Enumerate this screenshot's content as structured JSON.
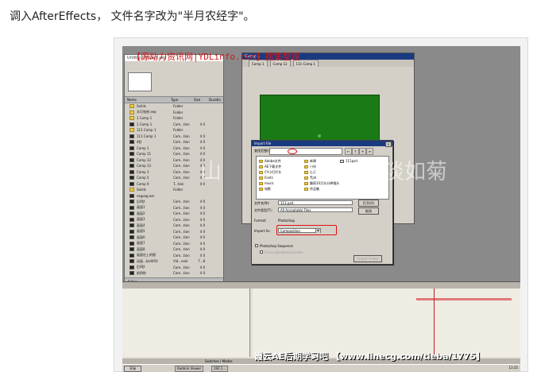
{
  "caption": "调入AfterEffects， 文件名字改为\"半月农经字\"。",
  "watermarks": {
    "top": "【源动力资讯网|YDLinfo.com】搜集整理",
    "calligraphy_left": "山",
    "calligraphy_mid": "素",
    "calligraphy_right": "淡如菊",
    "bottom": "霞云AE后期学习吧 【www.linecg.com/tieba/1775】"
  },
  "project": {
    "title": "Untitled Project.aep",
    "columns": [
      "Name",
      "Type",
      "Size",
      "Duratio"
    ],
    "items": [
      {
        "name": "Solids",
        "type": "Folder",
        "size": ""
      },
      {
        "name": "半月农经.aep",
        "type": "Folder",
        "size": ""
      },
      {
        "name": "1 Comp 1",
        "type": "Folder",
        "size": ""
      },
      {
        "name": "1 Comp 1",
        "type": "Com...tion",
        "size": "4 0"
      },
      {
        "name": "111 Comp 1",
        "type": "Folder",
        "size": ""
      },
      {
        "name": "111 Comp 1",
        "type": "Com...tion",
        "size": "4 0"
      },
      {
        "name": "4秒",
        "type": "Com...tion",
        "size": "4 0"
      },
      {
        "name": "Comp 1",
        "type": "Com...tion",
        "size": "4 0"
      },
      {
        "name": "Comp 11",
        "type": "Com...tion",
        "size": "4 0"
      },
      {
        "name": "Comp 12",
        "type": "Com...tion",
        "size": "4 0"
      },
      {
        "name": "Comp 13",
        "type": "Com...tion",
        "size": "4 0"
      },
      {
        "name": "Comp 3",
        "type": "Com...tion",
        "size": "4 0"
      },
      {
        "name": "Comp 5",
        "type": "Com...tion",
        "size": "4 0"
      },
      {
        "name": "Comp 9",
        "type": "T...tion",
        "size": "4 0"
      },
      {
        "name": "Solids",
        "type": "Folder",
        "size": ""
      },
      {
        "name": "vsguag.aar",
        "type": "",
        "size": ""
      },
      {
        "name": "后4秒",
        "type": "Com...tion",
        "size": "4 0"
      },
      {
        "name": "画面1",
        "type": "Com...tion",
        "size": "4 0"
      },
      {
        "name": "画面2",
        "type": "Com...tion",
        "size": "4 0"
      },
      {
        "name": "画面3",
        "type": "Com...tion",
        "size": "4 0"
      },
      {
        "name": "画面4",
        "type": "Com...tion",
        "size": "4 0"
      },
      {
        "name": "画面5",
        "type": "Com...tion",
        "size": "4 0"
      },
      {
        "name": "画面6",
        "type": "Com...tion",
        "size": "4 0"
      },
      {
        "name": "画面7",
        "type": "Com...tion",
        "size": "4 0"
      },
      {
        "name": "画面8",
        "type": "Com...tion",
        "size": "4 0"
      },
      {
        "name": "画面在上的图",
        "type": "Com...tion",
        "size": "4 0"
      },
      {
        "name": "动画...bz4450",
        "type": "Vid...evie",
        "size": "7...8"
      },
      {
        "name": "后4秒",
        "type": "Com...tion",
        "size": "4 0"
      },
      {
        "name": "前四秒",
        "type": "Com...tion",
        "size": "4 0"
      }
    ],
    "footer": "8 bpc"
  },
  "composition": {
    "title": "Comp 1",
    "tabs": [
      "Comp 1",
      "Comp 12",
      "111 Comp 1"
    ]
  },
  "import_dialog": {
    "title": "Import File",
    "look_in_label": "查找范围(I):",
    "files": [
      {
        "name": "Adobe文件",
        "kind": "folder"
      },
      {
        "name": "新建",
        "kind": "folder"
      },
      {
        "name": "AE下载文件",
        "kind": "folder"
      },
      {
        "name": "日程",
        "kind": "folder"
      },
      {
        "name": "CY小打仔头",
        "kind": "folder"
      },
      {
        "name": "社区",
        "kind": "folder"
      },
      {
        "name": "Fonts",
        "kind": "folder"
      },
      {
        "name": "素材",
        "kind": "folder"
      },
      {
        "name": "music",
        "kind": "folder"
      },
      {
        "name": "飘雨10月头分钟镜头",
        "kind": "folder"
      },
      {
        "name": "电影",
        "kind": "folder"
      },
      {
        "name": "作品集",
        "kind": "folder"
      },
      {
        "name": "111psd",
        "kind": "file"
      }
    ],
    "filename_label": "文件名(N):",
    "filename_value": "111.psd",
    "filetype_label": "文件类型(T):",
    "filetype_value": "All Acceptable Files",
    "open_button": "打开(O)",
    "cancel_button": "取消",
    "format_label": "Format:",
    "format_value": "Photoshop",
    "import_as_label": "Import As:",
    "import_as_value": "Composition",
    "sequence_label": "Photoshop Sequence",
    "force_label": "Force alphabetical order",
    "import_folder_button": "Import Folder"
  },
  "timeline": {
    "footer": "Switches / Modes"
  },
  "taskbar": {
    "start": "开始",
    "tasks": [
      "Radmin Viewer",
      "192.1..."
    ],
    "clock": "13:35"
  }
}
